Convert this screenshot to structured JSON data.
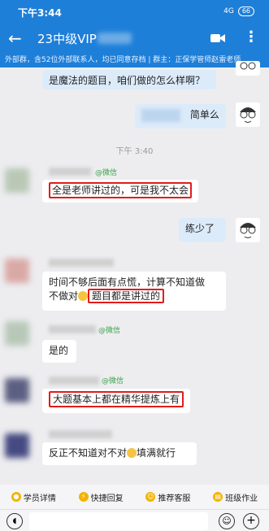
{
  "status": {
    "time": "下午3:44",
    "signal": "4G",
    "battery": "66"
  },
  "header": {
    "title": "23中级VIP"
  },
  "notice": "外部群，含52位外部联系人，均已同意存档 | 群主：正保学管师赵雷老师",
  "messages": [
    {
      "text": "是魔法的题目，咱们做的怎么样啊？"
    },
    {
      "text": "简单么"
    },
    {
      "text": "全是老师讲过的，可是我不太会",
      "tag": "@微信"
    },
    {
      "text": "练少了"
    },
    {
      "text1": "时间不够后面有点慌，计算不知道做",
      "text2": "不做对",
      "text3": "题目都是讲过的"
    },
    {
      "text": "是的",
      "tag": "@微信"
    },
    {
      "text": "大题基本上都在精华提炼上有",
      "tag": "@微信"
    },
    {
      "text1": "反正不知道对不对",
      "text2": "填满就行"
    }
  ],
  "timestamp": "下午 3:40",
  "quick": [
    "学员详情",
    "快捷回复",
    "推荐客服",
    "班级作业"
  ]
}
